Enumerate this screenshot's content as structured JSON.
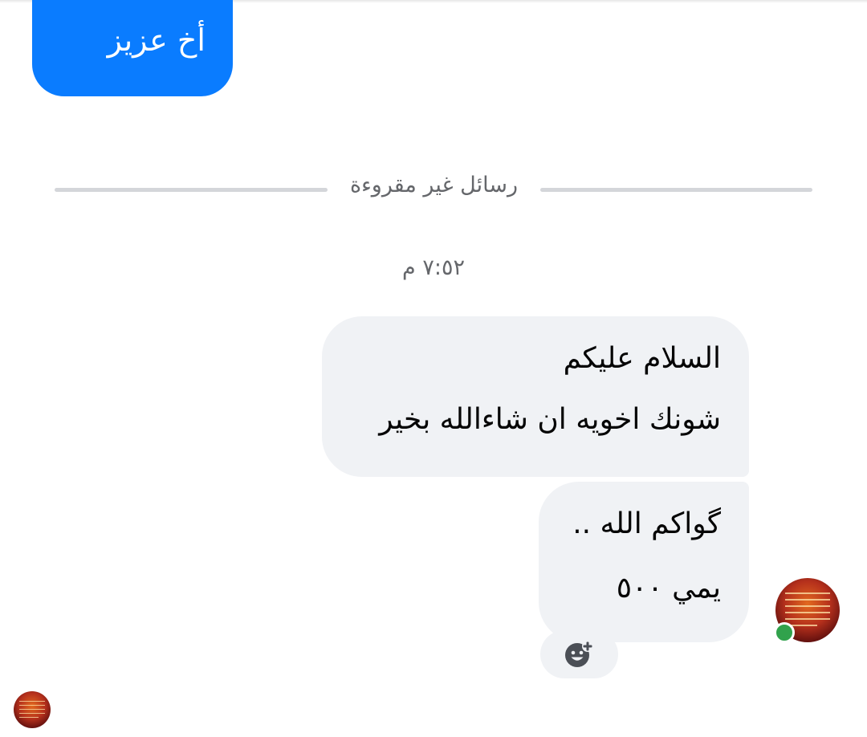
{
  "sent_message": {
    "text": "أخ عزيز"
  },
  "divider": {
    "label": "رسائل غير مقروءة"
  },
  "timestamp": "٧:٥٢ م",
  "received_messages": [
    {
      "lines": [
        "السلام عليكم",
        "شونك اخويه ان شاءالله بخير"
      ]
    },
    {
      "lines": [
        "گواكم الله ..",
        "يمي ٥٠٠"
      ]
    }
  ],
  "reaction_button": {
    "icon": "add-reaction-icon"
  },
  "sender": {
    "avatar_icon": "profile-avatar",
    "online": true
  },
  "read_receipt": {
    "avatar_icon": "seen-by-avatar"
  },
  "colors": {
    "sent_bubble": "#0a7cff",
    "received_bubble": "#f0f2f5",
    "online": "#31a24c",
    "secondary_text": "#65676b"
  }
}
